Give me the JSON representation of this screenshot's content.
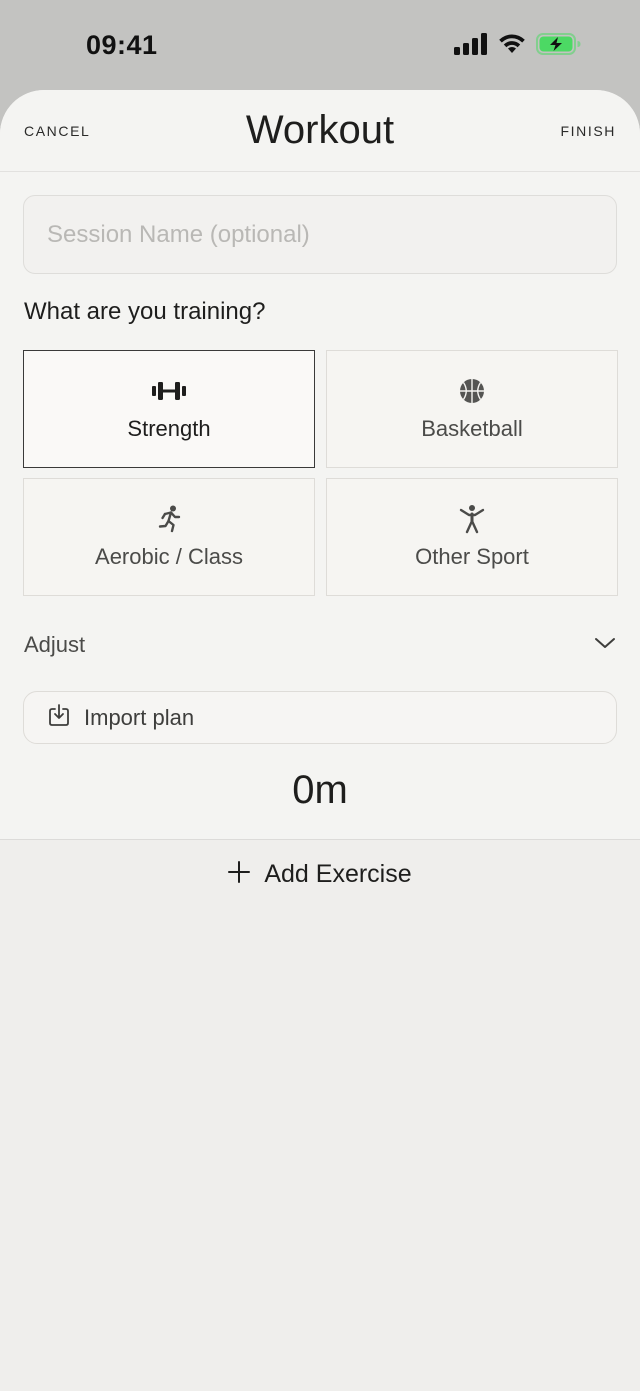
{
  "status_bar": {
    "time": "09:41"
  },
  "header": {
    "cancel_label": "CANCEL",
    "title": "Workout",
    "finish_label": "FINISH"
  },
  "session": {
    "placeholder": "Session Name (optional)",
    "value": ""
  },
  "training": {
    "question": "What are you training?",
    "options": [
      {
        "label": "Strength",
        "icon": "dumbbell-icon",
        "selected": true
      },
      {
        "label": "Basketball",
        "icon": "basketball-icon",
        "selected": false
      },
      {
        "label": "Aerobic / Class",
        "icon": "running-icon",
        "selected": false
      },
      {
        "label": "Other Sport",
        "icon": "person-arms-up-icon",
        "selected": false
      }
    ]
  },
  "adjust": {
    "label": "Adjust",
    "icon": "chevron-down-icon"
  },
  "import_plan": {
    "label": "Import plan",
    "icon": "import-icon"
  },
  "duration": "0m",
  "add_exercise": {
    "label": "Add Exercise",
    "icon": "plus-icon"
  },
  "colors": {
    "status_bar_bg": "#c3c3c1",
    "sheet_bg": "#efeeec",
    "battery_green": "#4cd964",
    "text": "#1e1e1d",
    "selected_border": "#3a3a39"
  }
}
